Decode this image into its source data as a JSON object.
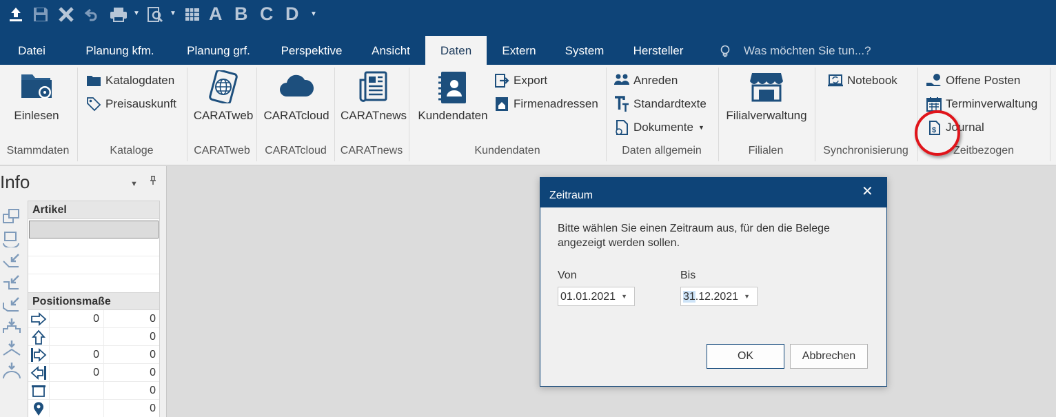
{
  "qat": {
    "letters": [
      "A",
      "B",
      "C",
      "D"
    ],
    "icons": [
      "upload-icon",
      "save-icon",
      "close-icon",
      "undo-icon",
      "print-icon",
      "print-preview-icon",
      "columns-icon"
    ]
  },
  "tabs": [
    {
      "label": "Datei"
    },
    {
      "label": "Planung kfm."
    },
    {
      "label": "Planung grf."
    },
    {
      "label": "Perspektive"
    },
    {
      "label": "Ansicht"
    },
    {
      "label": "Daten"
    },
    {
      "label": "Extern"
    },
    {
      "label": "System"
    },
    {
      "label": "Hersteller"
    }
  ],
  "active_tab": "Daten",
  "tell_me": "Was möchten Sie tun...?",
  "ribbon": {
    "stammdaten": {
      "group": "Stammdaten",
      "einlesen": "Einlesen"
    },
    "kataloge": {
      "group": "Kataloge",
      "katalogdaten": "Katalogdaten",
      "preisauskunft": "Preisauskunft"
    },
    "caratweb": {
      "group": "CARATweb",
      "button": "CARATweb"
    },
    "caratcloud": {
      "group": "CARATcloud",
      "button": "CARATcloud"
    },
    "caratnews": {
      "group": "CARATnews",
      "button": "CARATnews"
    },
    "kundendaten": {
      "group": "Kundendaten",
      "button": "Kundendaten",
      "export": "Export",
      "firmenadressen": "Firmenadressen"
    },
    "daten_allgemein": {
      "group": "Daten allgemein",
      "anreden": "Anreden",
      "standardtexte": "Standardtexte",
      "dokumente": "Dokumente"
    },
    "filialen": {
      "group": "Filialen",
      "button": "Filialverwaltung"
    },
    "synchronisierung": {
      "group": "Synchronisierung",
      "notebook": "Notebook"
    },
    "zeitbezogen": {
      "group": "Zeitbezogen",
      "offene_posten": "Offene Posten",
      "terminverwaltung": "Terminverwaltung",
      "journal": "Journal"
    }
  },
  "info_panel": {
    "title": "Info",
    "artikel_header": "Artikel",
    "positionsmasse_header": "Positionsmaße",
    "rows": [
      {
        "icon": "arrow-right-icon",
        "c1": "0",
        "c2": "0"
      },
      {
        "icon": "arrow-up-icon",
        "c1": "",
        "c2": "0"
      },
      {
        "icon": "arrow-right-bar-icon",
        "c1": "0",
        "c2": "0"
      },
      {
        "icon": "arrow-left-bar-icon",
        "c1": "0",
        "c2": "0"
      },
      {
        "icon": "bracket-icon",
        "c1": "",
        "c2": "0"
      },
      {
        "icon": "location-pin-icon",
        "c1": "",
        "c2": "0"
      }
    ]
  },
  "dialog": {
    "title": "Zeitraum",
    "close": "✕",
    "message": "Bitte wählen Sie einen Zeitraum aus, für den die Belege angezeigt werden sollen.",
    "von_label": "Von",
    "von_value": "01.01.2021",
    "bis_label": "Bis",
    "bis_day": "31",
    "bis_rest": ".12.2021",
    "ok": "OK",
    "cancel": "Abbrechen"
  },
  "colors": {
    "brand": "#0e4478",
    "ribbon_bg": "#f3f3f3",
    "highlight_circle": "#e0141a"
  }
}
